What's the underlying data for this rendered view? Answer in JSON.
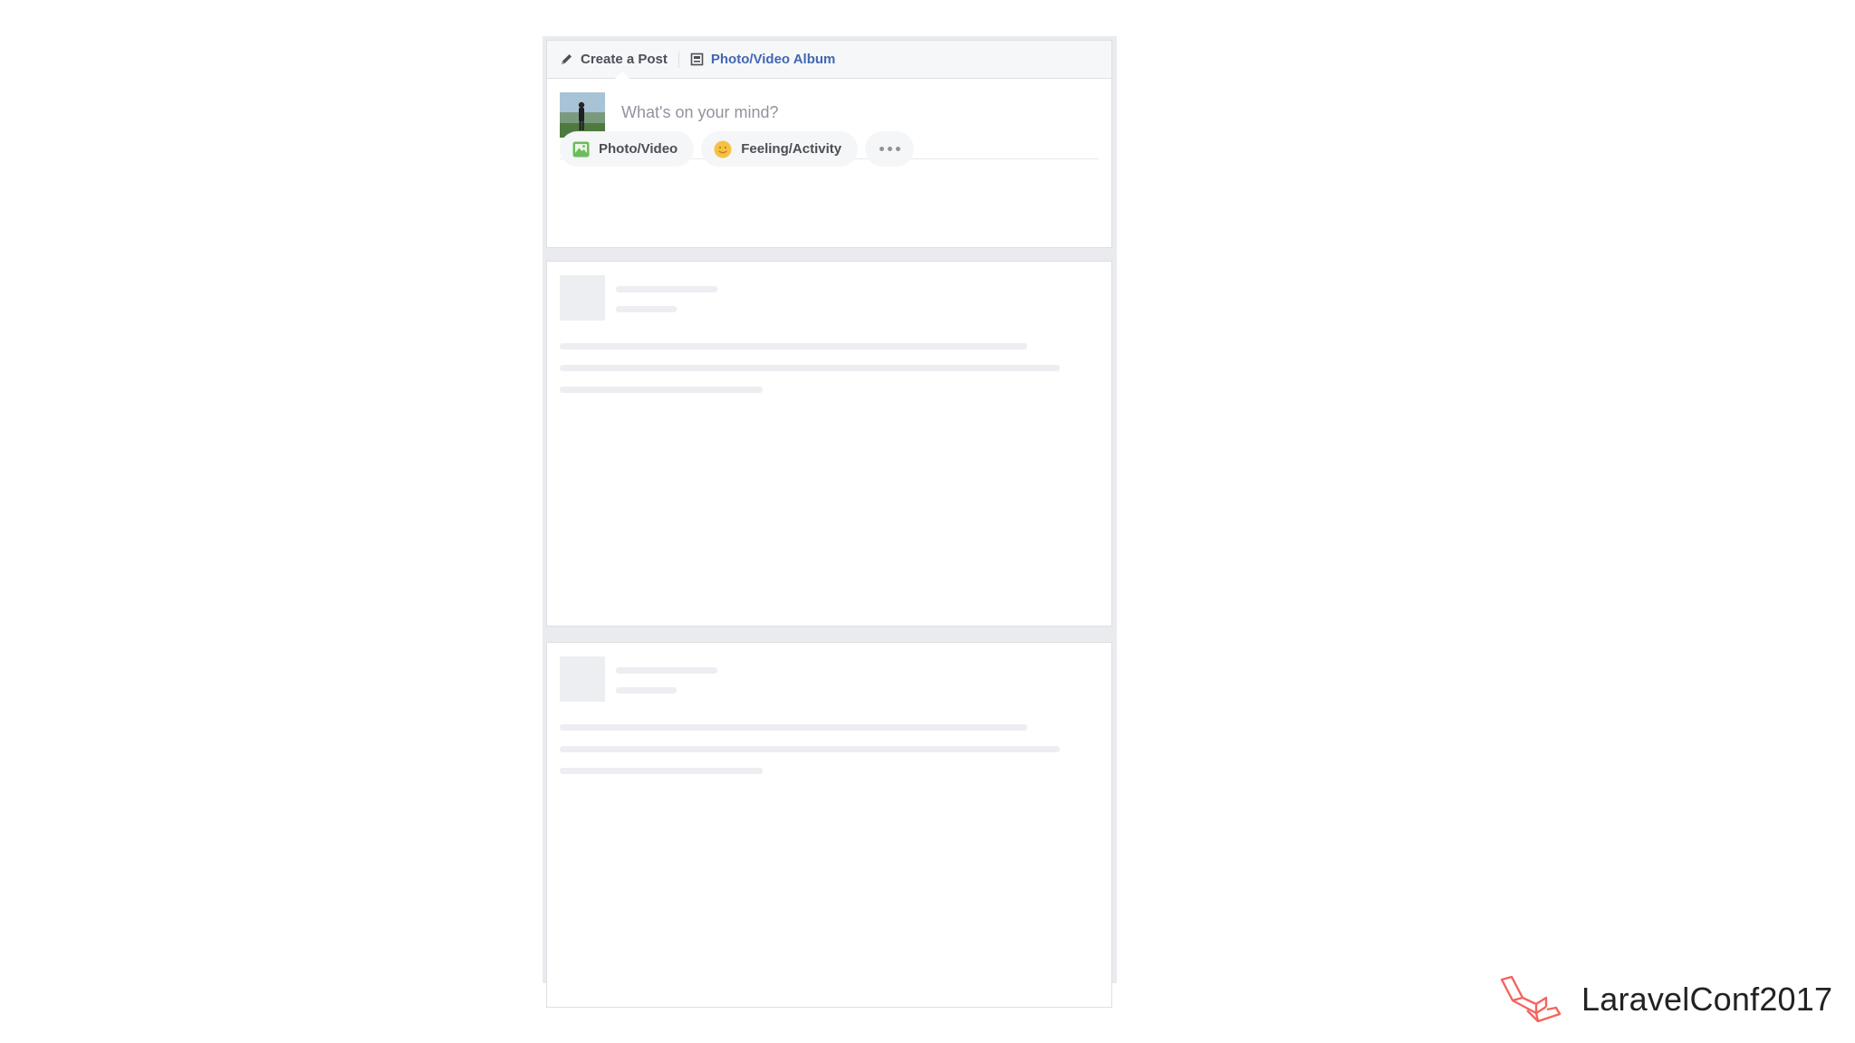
{
  "composer": {
    "tabs": [
      {
        "label": "Create a Post",
        "icon": "pencil-icon"
      },
      {
        "label": "Photo/Video Album",
        "icon": "album-icon"
      }
    ],
    "placeholder": "What's on your mind?",
    "actions": [
      {
        "label": "Photo/Video",
        "icon": "photo-icon"
      },
      {
        "label": "Feeling/Activity",
        "icon": "smiley-icon"
      }
    ],
    "more_icon": "ellipsis-icon"
  },
  "brand": {
    "text": "LaravelConf2017",
    "logo": "laravel-logo",
    "color": "#f4645f"
  },
  "colors": {
    "feed_bg": "#e9ebee",
    "link_blue": "#4267b2",
    "text_dark": "#4b4f56",
    "placeholder": "#90949c",
    "skeleton": "#eceef1"
  }
}
